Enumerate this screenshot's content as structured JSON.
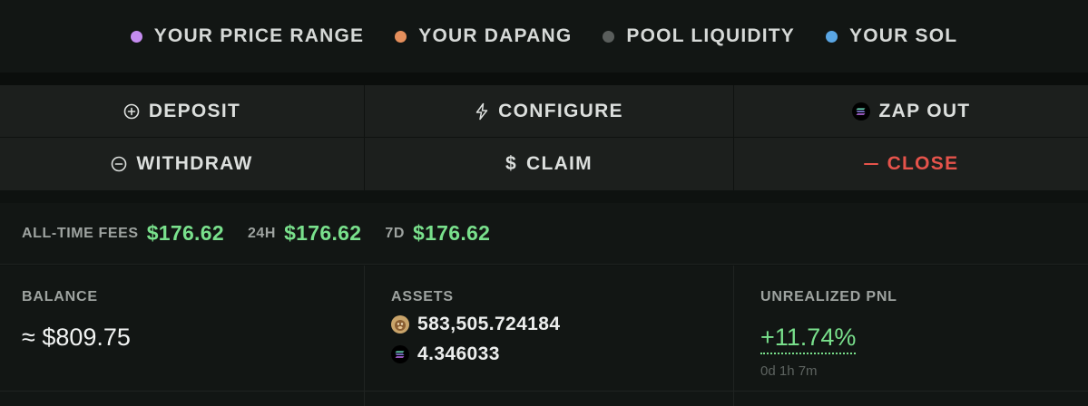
{
  "legend": {
    "items": [
      {
        "label": "YOUR PRICE RANGE",
        "color": "#c58cf0"
      },
      {
        "label": "YOUR DAPANG",
        "color": "#e58f5c"
      },
      {
        "label": "POOL LIQUIDITY",
        "color": "#5a5e5c"
      },
      {
        "label": "YOUR SOL",
        "color": "#5aa6e4"
      }
    ]
  },
  "actions": {
    "deposit": {
      "label": "DEPOSIT",
      "icon": "plus-circle-icon"
    },
    "configure": {
      "label": "CONFIGURE",
      "icon": "lightning-icon"
    },
    "zap_out": {
      "label": "ZAP OUT",
      "icon": "solana-icon"
    },
    "withdraw": {
      "label": "WITHDRAW",
      "icon": "minus-circle-icon"
    },
    "claim": {
      "label": "CLAIM",
      "icon": "$"
    },
    "close": {
      "label": "CLOSE",
      "icon": "minus-icon",
      "color": "#e5534b"
    }
  },
  "fees": {
    "all_time": {
      "label": "ALL-TIME FEES",
      "value": "$176.62"
    },
    "h24": {
      "label": "24H",
      "value": "$176.62"
    },
    "d7": {
      "label": "7D",
      "value": "$176.62"
    }
  },
  "stats": {
    "balance": {
      "label": "BALANCE",
      "value": "≈ $809.75"
    },
    "assets": {
      "label": "ASSETS",
      "items": [
        {
          "token": "dapang-token-icon",
          "amount": "583,505.724184"
        },
        {
          "token": "solana-token-icon",
          "amount": "4.346033"
        }
      ]
    },
    "pnl": {
      "label": "UNREALIZED PNL",
      "value": "+11.74%",
      "duration": "0d 1h 7m"
    }
  }
}
